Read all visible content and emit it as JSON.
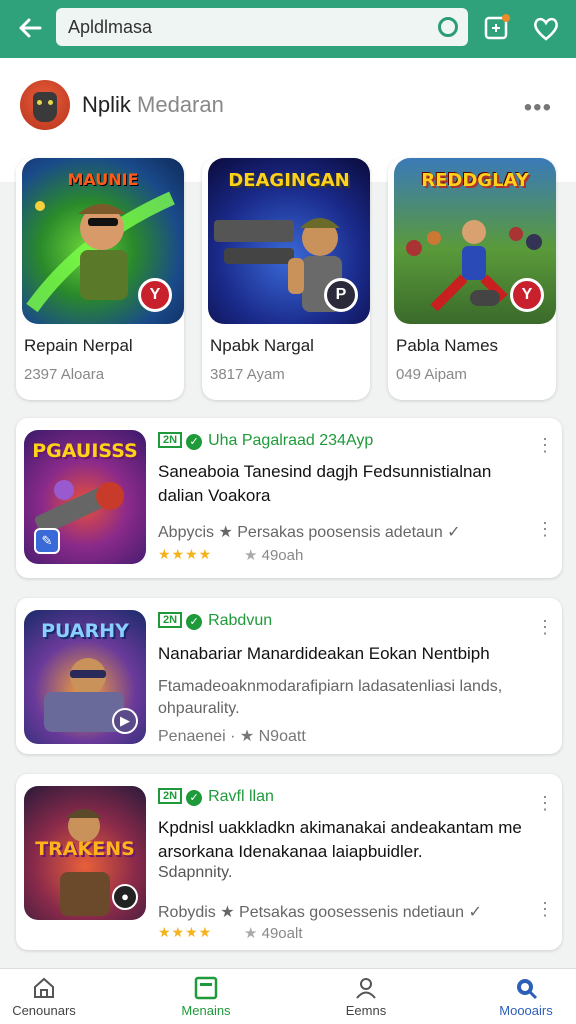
{
  "search": {
    "value": "Apldlmasa"
  },
  "profile": {
    "name_dark": "Nplik ",
    "name_light": "Medaran"
  },
  "featured": [
    {
      "name": "Repain Nerpal",
      "meta": "2397 Aloara",
      "art_title": "MAUNIE",
      "badge": "Y"
    },
    {
      "name": "Npabk Nargal",
      "meta": "3817 Ayam",
      "art_title": "DEAGINGAN",
      "badge": "P"
    },
    {
      "name": "Pabla Names",
      "meta": "049 Aipam",
      "art_title": "REDDGLAY",
      "badge": "Y"
    }
  ],
  "list": [
    {
      "art_title": "PGAUISSS",
      "tag_box": "2N",
      "tag_label": "Uha Pagalraad 234Ayp",
      "title": "Saneaboia Tanesind dagjh Fedsunnistialnan dalian Voakora",
      "sub": "Abpycis ★ Persakas poosensis adetaun ✓",
      "stars": "★★★★",
      "rating": "49oah"
    },
    {
      "art_title": "PUARHY",
      "tag_box": "2N",
      "tag_label": "Rabdvun",
      "title": "Nanabariar Manardideakan Eokan Nentbiph",
      "sub": "Ftamadeoaknmodarafipiarn ladasatenliasi lands, ohpaurality.",
      "meta": "Penaenei · ★ N9oatt"
    },
    {
      "art_title": "TRAKENS",
      "tag_box": "2N",
      "tag_label": "Ravfl llan",
      "title": "Kpdnisl uakkladkn akimanakai andeakantam me arsorkana Idenakanaa laiapbuidler.",
      "extra": "Sdapnnity.",
      "sub": "Robydis ★ Petsakas goosessenis ndetiaun ✓",
      "stars": "★★★★",
      "rating": "49oalt"
    }
  ],
  "nav": [
    {
      "label": "Cenounars",
      "icon": "home-icon"
    },
    {
      "label": "Menains",
      "icon": "apps-icon"
    },
    {
      "label": "Eemns",
      "icon": "person-icon"
    },
    {
      "label": "Moooairs",
      "icon": "search-icon"
    }
  ],
  "colors": {
    "brand": "#2fa27c",
    "accent_green": "#1f9a3a",
    "active_nav": "#1f9a3a",
    "active_nav2": "#2d5fb8"
  }
}
